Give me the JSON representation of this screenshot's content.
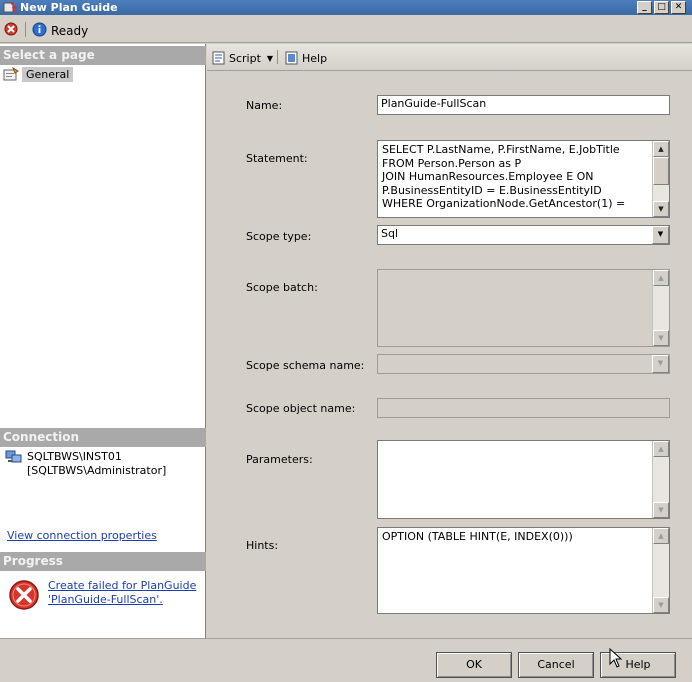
{
  "window": {
    "title": "New Plan Guide",
    "controls": [
      "minimize",
      "maximize",
      "close"
    ]
  },
  "status": {
    "text": "Ready"
  },
  "left": {
    "select_page_header": "Select a page",
    "pages": [
      {
        "label": "General",
        "icon": "page-properties-icon"
      }
    ],
    "connection_header": "Connection",
    "server": "SQLTBWS\\INST01",
    "user": "[SQLTBWS\\Administrator]",
    "view_connection_link": "View connection properties",
    "progress_header": "Progress",
    "progress_line1": "Create failed for PlanGuide",
    "progress_line2": "'PlanGuide-FullScan'."
  },
  "toolbar": {
    "script_label": "Script",
    "help_label": "Help"
  },
  "form": {
    "name_label": "Name:",
    "name_value": "PlanGuide-FullScan",
    "statement_label": "Statement:",
    "statement_lines": [
      "SELECT P.LastName, P.FirstName, E.JobTitle",
      "FROM Person.Person as P",
      "JOIN HumanResources.Employee E ON",
      "P.BusinessEntityID = E.BusinessEntityID",
      "WHERE OrganizationNode.GetAncestor(1) ="
    ],
    "scope_type_label": "Scope type:",
    "scope_type_value": "Sql",
    "scope_batch_label": "Scope batch:",
    "scope_schema_label": "Scope schema name:",
    "scope_object_label": "Scope object name:",
    "parameters_label": "Parameters:",
    "hints_label": "Hints:",
    "hints_value": "OPTION (TABLE HINT(E, INDEX(0)))"
  },
  "buttons": {
    "ok": "OK",
    "cancel": "Cancel",
    "help": "Help"
  }
}
